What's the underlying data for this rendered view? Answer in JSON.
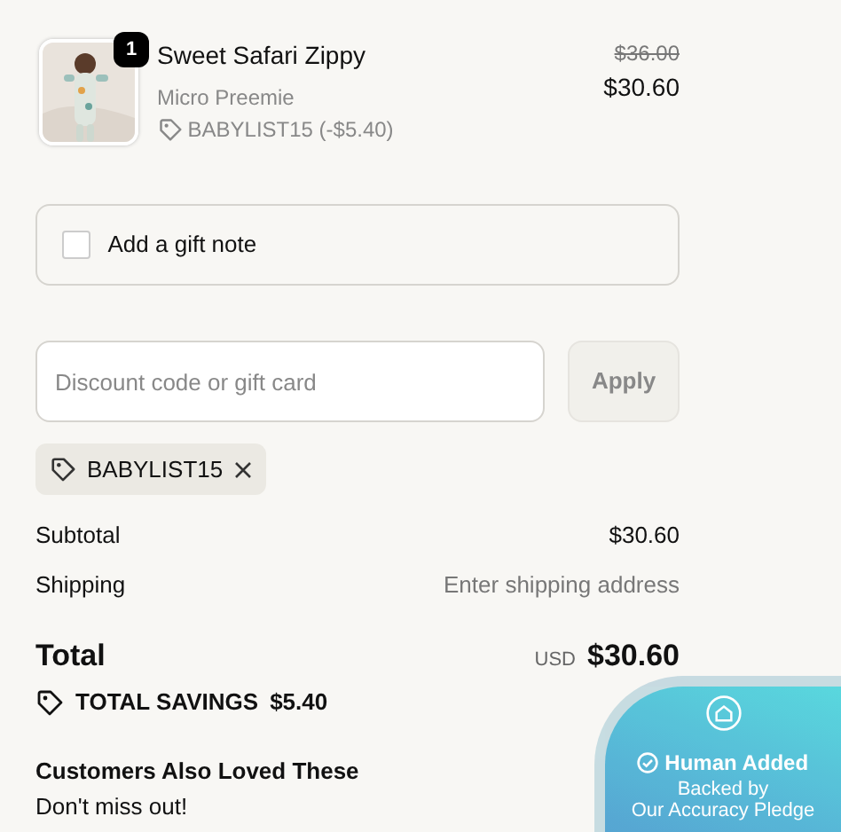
{
  "cart_item": {
    "quantity": "1",
    "title": "Sweet Safari Zippy",
    "variant": "Micro Preemie",
    "discount": "BABYLIST15 (-$5.40)",
    "original_price": "$36.00",
    "price": "$30.60"
  },
  "gift_note": {
    "label": "Add a gift note",
    "checked": false
  },
  "discount_field": {
    "placeholder": "Discount code or gift card",
    "button": "Apply"
  },
  "applied_codes": [
    {
      "code": "BABYLIST15"
    }
  ],
  "summary": [
    {
      "label": "Subtotal",
      "value": "$30.60",
      "kind": "amount"
    },
    {
      "label": "Shipping",
      "value": "Enter shipping address",
      "kind": "hint"
    }
  ],
  "total": {
    "label": "Total",
    "currency": "USD",
    "amount": "$30.60"
  },
  "savings": {
    "label": "TOTAL SAVINGS",
    "amount": "$5.40"
  },
  "recommendations": {
    "title": "Customers Also Loved These",
    "subtitle": "Don't miss out!"
  },
  "pledge_badge": {
    "title": "Human Added",
    "line_1": "Backed by",
    "line_2": "Our Accuracy Pledge"
  }
}
